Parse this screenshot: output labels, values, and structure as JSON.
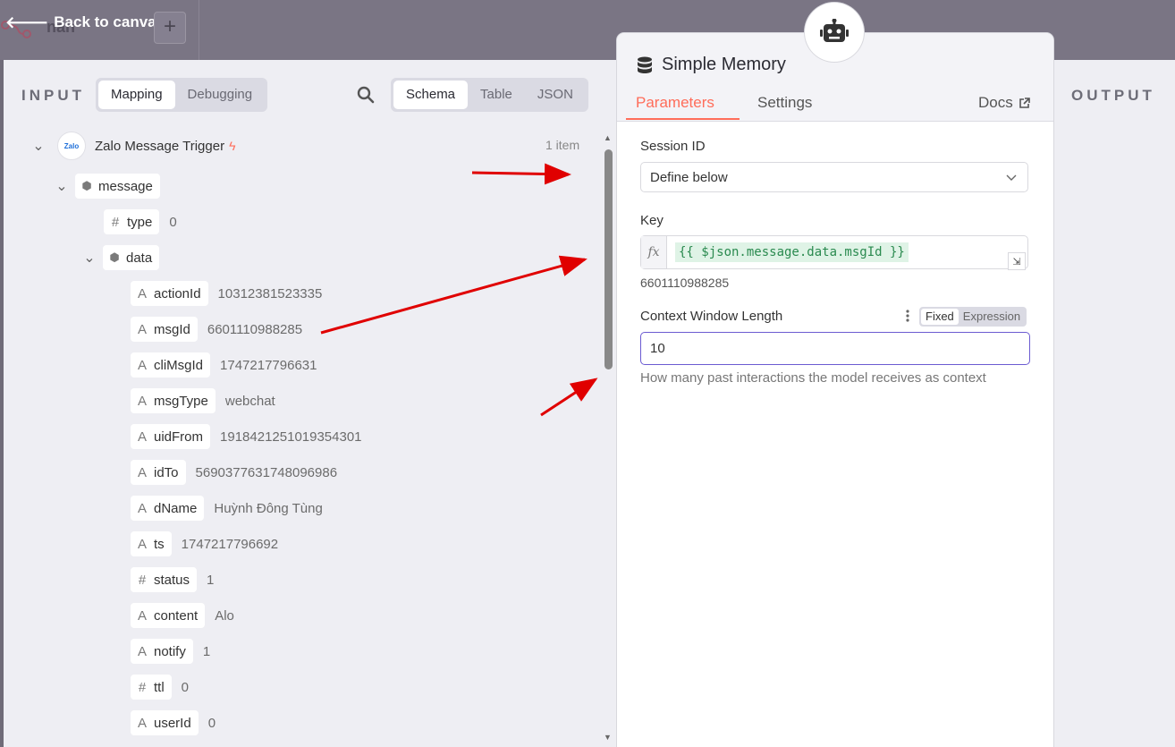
{
  "topbar": {
    "back_label": "Back to canvas",
    "workflow_name_partial": "nan",
    "add_label": "+"
  },
  "input": {
    "label": "INPUT",
    "mode_options": [
      "Mapping",
      "Debugging"
    ],
    "mode_selected": "Mapping",
    "view_options": [
      "Schema",
      "Table",
      "JSON"
    ],
    "view_selected": "Schema",
    "trigger": {
      "name": "Zalo Message Trigger",
      "logo_text": "Zalo",
      "item_count": "1 item"
    },
    "tree": {
      "message": "message",
      "type_key": "type",
      "type_val": "0",
      "data": "data",
      "fields": [
        {
          "type_icon": "A",
          "key": "actionId",
          "value": "10312381523335"
        },
        {
          "type_icon": "A",
          "key": "msgId",
          "value": "6601110988285"
        },
        {
          "type_icon": "A",
          "key": "cliMsgId",
          "value": "1747217796631"
        },
        {
          "type_icon": "A",
          "key": "msgType",
          "value": "webchat"
        },
        {
          "type_icon": "A",
          "key": "uidFrom",
          "value": "1918421251019354301"
        },
        {
          "type_icon": "A",
          "key": "idTo",
          "value": "5690377631748096986"
        },
        {
          "type_icon": "A",
          "key": "dName",
          "value": "Huỳnh Đông Tùng"
        },
        {
          "type_icon": "A",
          "key": "ts",
          "value": "1747217796692"
        },
        {
          "type_icon": "#",
          "key": "status",
          "value": "1"
        },
        {
          "type_icon": "A",
          "key": "content",
          "value": "Alo"
        },
        {
          "type_icon": "A",
          "key": "notify",
          "value": "1"
        },
        {
          "type_icon": "#",
          "key": "ttl",
          "value": "0"
        },
        {
          "type_icon": "A",
          "key": "userId",
          "value": "0"
        }
      ]
    }
  },
  "node": {
    "title": "Simple Memory",
    "tabs": [
      "Parameters",
      "Settings"
    ],
    "active_tab": "Parameters",
    "docs_label": "Docs",
    "session_id": {
      "label": "Session ID",
      "value": "Define below"
    },
    "key": {
      "label": "Key",
      "fx": "fx",
      "expression": "{{ $json.message.data.msgId }}",
      "resolved": "6601110988285"
    },
    "context_window": {
      "label": "Context Window Length",
      "mode_options": [
        "Fixed",
        "Expression"
      ],
      "mode_selected": "Fixed",
      "value": "10",
      "hint": "How many past interactions the model receives as context"
    }
  },
  "output": {
    "label": "OUTPUT"
  },
  "colors": {
    "accent": "#ff6d5a",
    "annotation_arrow": "#e00000",
    "expression_green": "#2a8a4f",
    "focus_border": "#6b5bd1"
  }
}
